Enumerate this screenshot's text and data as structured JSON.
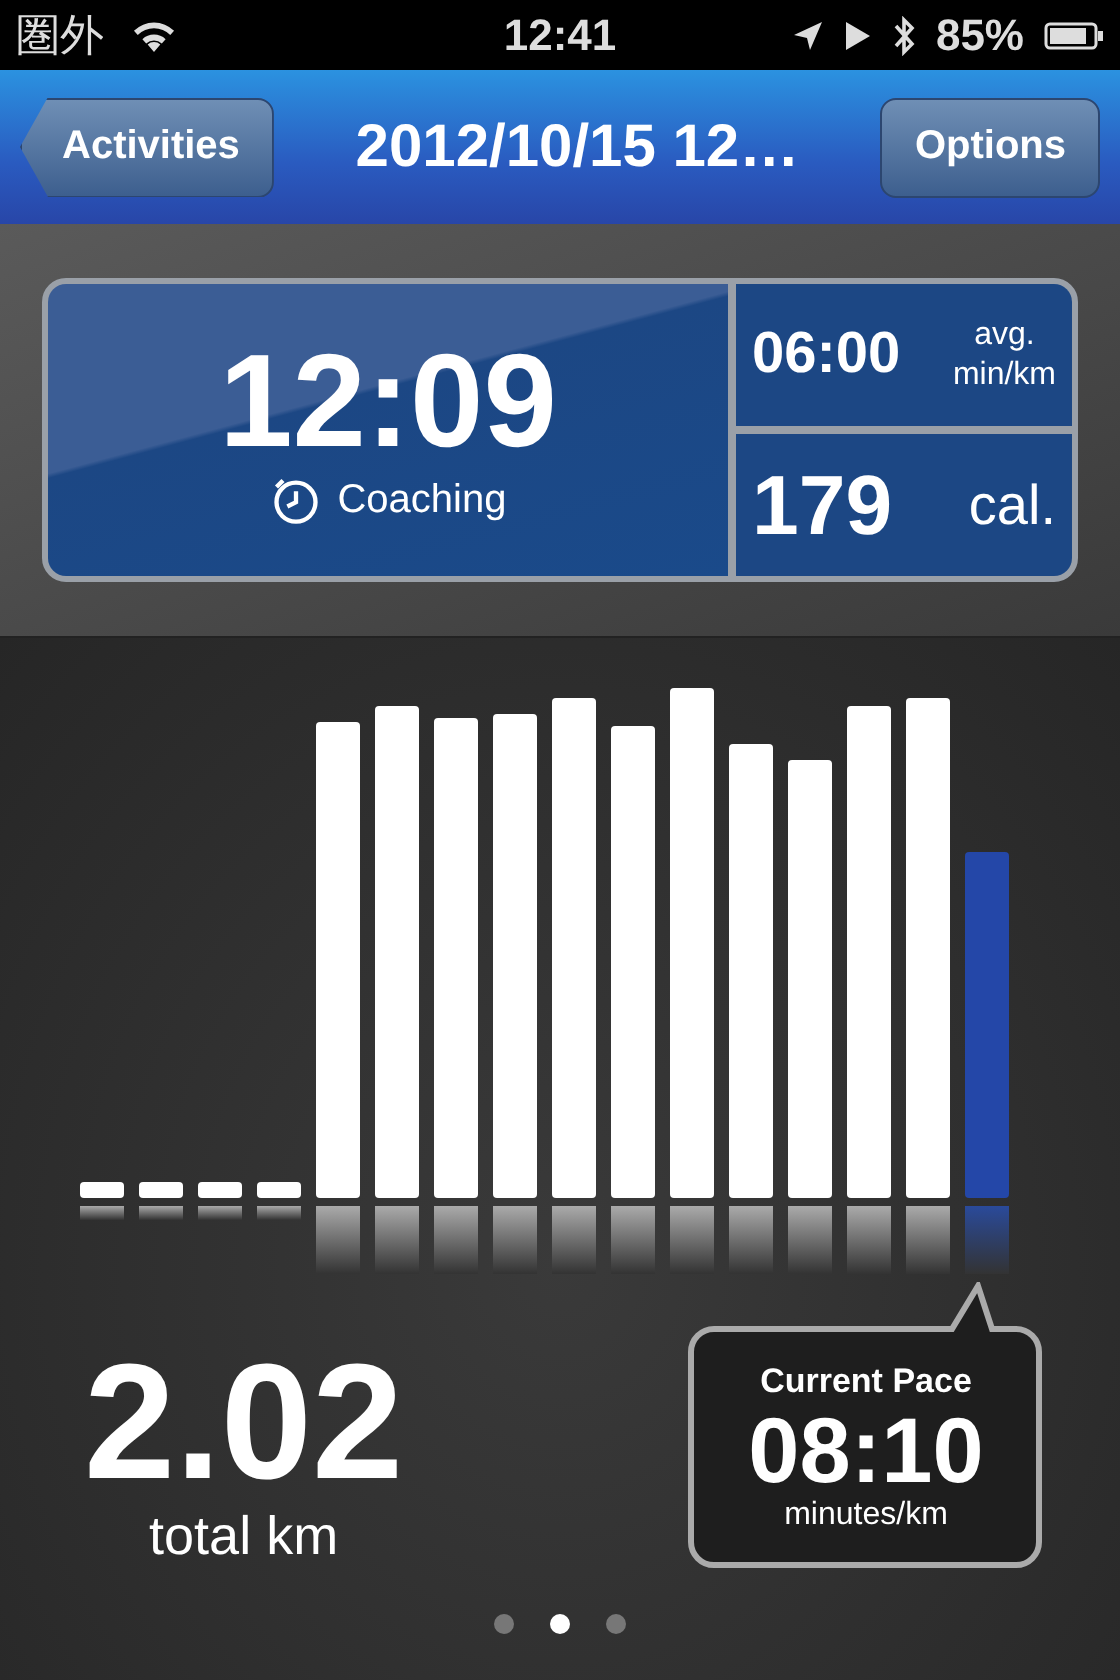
{
  "status_bar": {
    "carrier": "圏外",
    "time": "12:41",
    "battery": "85%"
  },
  "nav_bar": {
    "back_button": "Activities",
    "title": "2012/10/15 12…",
    "options_button": "Options"
  },
  "summary": {
    "duration": "12:09",
    "coaching": "Coaching",
    "avg_pace": "06:00",
    "avg_pace_label": "avg.",
    "avg_pace_unit": "min/km",
    "calories": "179",
    "calories_unit": "cal."
  },
  "distance": {
    "value": "2.02",
    "unit": "total km"
  },
  "current_pace": {
    "title": "Current Pace",
    "value": "08:10",
    "unit": "minutes/km"
  },
  "pages": [
    {
      "selected": false
    },
    {
      "selected": true
    },
    {
      "selected": false
    }
  ]
}
